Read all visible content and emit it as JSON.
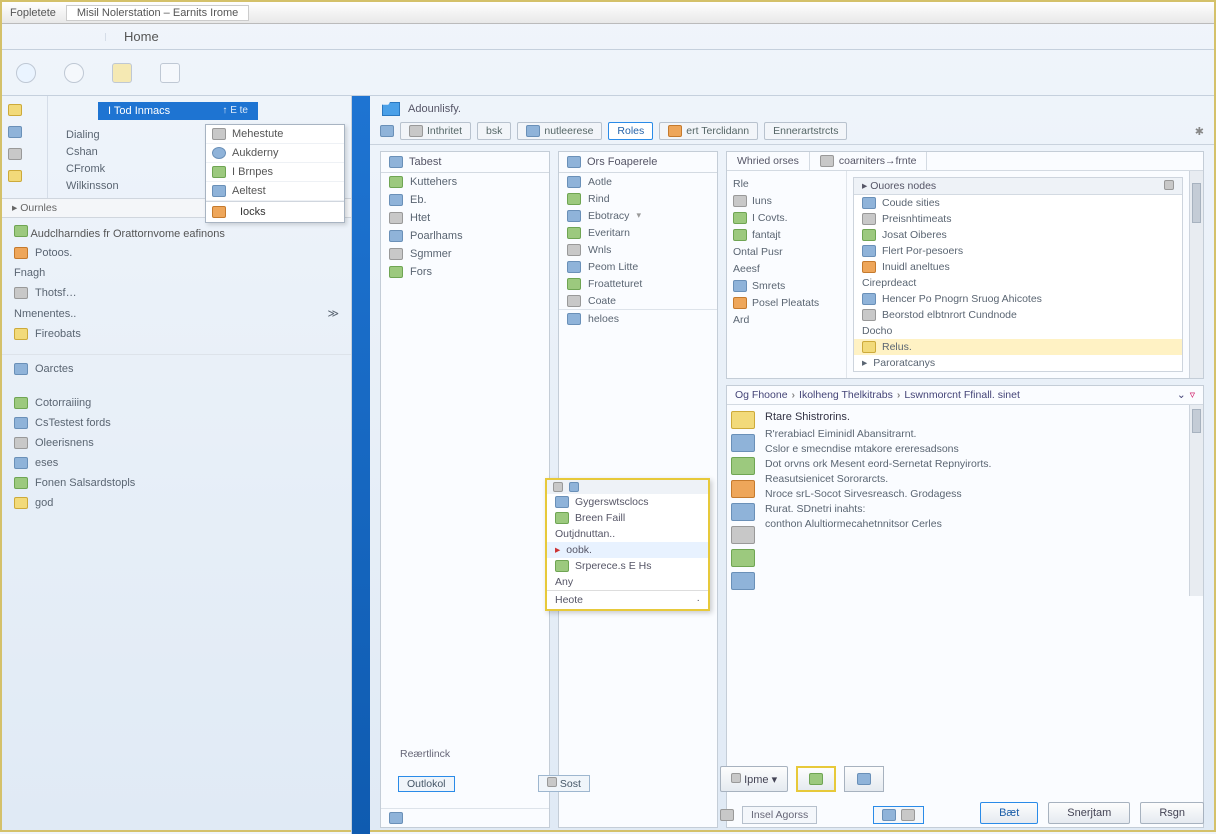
{
  "titlebar": {
    "left": "Fopletete",
    "tab": "Misil Nolerstation – Earnits Irome"
  },
  "menubar": {
    "home": "Home"
  },
  "sidebar_top": {
    "blue_tab": "I Tod Inmacs",
    "blue_tab_sub": "↑ E te",
    "popup": [
      "Mehestute",
      "Aukderny",
      "I Brnpes",
      "Aeltest"
    ],
    "popup_low": "Iocks",
    "nav": [
      "Dialing",
      "Cshan",
      "CFromk",
      "Wilkinsson"
    ]
  },
  "sidebar_mid_head": "Ournles",
  "sidebar_mid": {
    "header": "Audclharndies fr Orattornvome eafinons",
    "items": [
      "Potoos.",
      "Fnagh",
      "Thotsf…",
      "Nmenentes..",
      "Fireobats"
    ]
  },
  "sidebar_low": [
    "Oarctes",
    "Cotorraiiing",
    "CsTestest fords",
    "Oleerisnens",
    "eses",
    "Fonen Salsardstopls",
    "god"
  ],
  "addr": "Adounlisfy.",
  "tabs1": [
    "Inthritet",
    "bsk",
    "nutleerese",
    "Roles",
    "ert  Terclidann",
    "Ennerartstrcts"
  ],
  "cb_left": {
    "head": "Tabest",
    "rows": [
      "Kuttehers",
      "Eb.",
      "Htet",
      "Poarlhams",
      "Sgmmer",
      "Fors"
    ]
  },
  "cb_mid": {
    "head": "Ors Foaperele",
    "rows": [
      "Aotle",
      "Rind",
      "Ebotracy",
      "Everitarn",
      "Wnls",
      "Peom Litte",
      "Froatteturet",
      "Coate",
      "heloes"
    ]
  },
  "panel_tabs": [
    "Whried orses",
    "coarniters→frnte"
  ],
  "pnav": [
    "Rle",
    "Iuns",
    "I Covts.",
    "fantajt",
    "Ontal Pusr",
    "Aeesf",
    "Smrets",
    "Posel Pleatats",
    "Ard"
  ],
  "plist_head": "Ouores nodes",
  "plist": [
    "Coude sities",
    "Preisnhtimeats",
    "Josat Oiberes",
    "Flert Por-pesoers",
    "Inuidl aneltues",
    "Cireprdeact",
    "Hencer Po Pnogrn Sruog Ahicotes",
    "Beorstod elbtnrort Cundnode",
    "Docho",
    "Relus.",
    "Paroratcanys"
  ],
  "bc": [
    "Og Fhoone",
    "Ikolheng Thelkitrabs",
    "Lswnmorcnt Ffinall. sinet"
  ],
  "detail_title": "Rtare Shistrorins.",
  "detail": [
    "R'rerabiacl Eiminidl Abansitrarnt.",
    "Cslor e smecndise mtakore ereresadsons",
    "Dot orvns ork Mesent eord-Sernetat Repnyirorts.",
    "Reasutsienicet Sororarcts.",
    "Nroce srL-Socot Sirvesreasch. Grodagess",
    "Rurat. SDnetri inahts:",
    "conthon Alultiormecahetnnitsor Cerles"
  ],
  "mini_head": "Gygerswtsclocs",
  "mini": [
    "Breen Faill",
    "Outjdnuttan..",
    "oobk.",
    "Srperece.s E Hs",
    "Any"
  ],
  "mini_foot_l": "Heote",
  "small_lbl": "Reærtlinck",
  "outlook": "Outlokol",
  "sort_lbl": "Sost",
  "status_lbl": "Insel Agorss",
  "btns": {
    "back": "Bæt",
    "next": "Snerjtam",
    "cancel": "Rsgn",
    "mid": "Ipme"
  }
}
